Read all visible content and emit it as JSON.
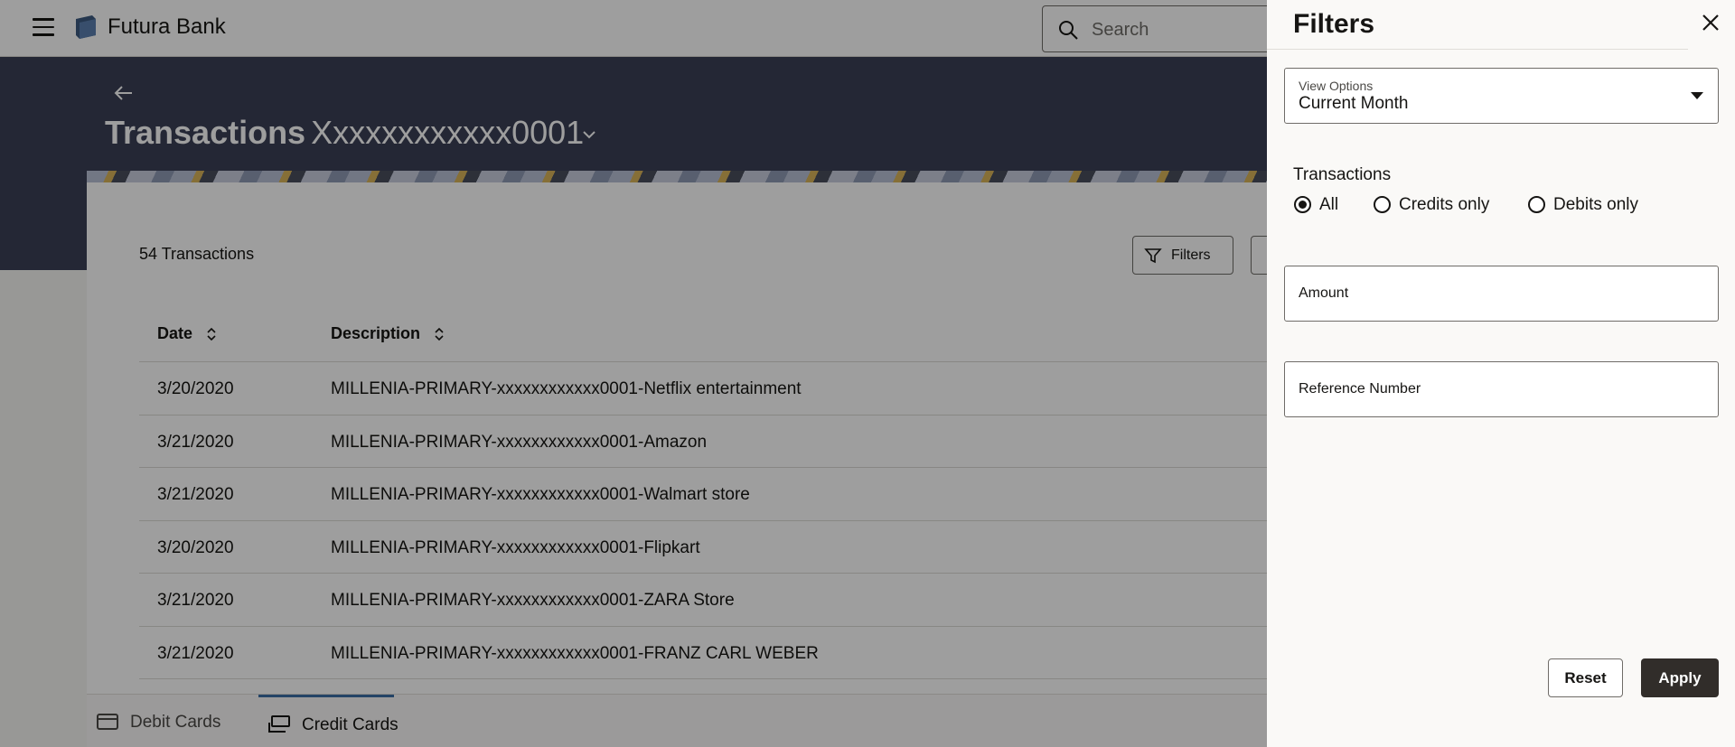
{
  "header": {
    "brand": "Futura Bank",
    "search_placeholder": "Search"
  },
  "page": {
    "title_bold": "Transactions",
    "account": "Xxxxxxxxxxxx0001"
  },
  "transactions": {
    "count_label": "54 Transactions",
    "filters_label": "Filters",
    "columns": {
      "date": "Date",
      "description": "Description"
    },
    "rows": [
      {
        "date": "3/20/2020",
        "description": "MILLENIA-PRIMARY-xxxxxxxxxxxx0001-Netflix entertainment"
      },
      {
        "date": "3/21/2020",
        "description": "MILLENIA-PRIMARY-xxxxxxxxxxxx0001-Amazon"
      },
      {
        "date": "3/21/2020",
        "description": "MILLENIA-PRIMARY-xxxxxxxxxxxx0001-Walmart store"
      },
      {
        "date": "3/20/2020",
        "description": "MILLENIA-PRIMARY-xxxxxxxxxxxx0001-Flipkart"
      },
      {
        "date": "3/21/2020",
        "description": "MILLENIA-PRIMARY-xxxxxxxxxxxx0001-ZARA Store"
      },
      {
        "date": "3/21/2020",
        "description": "MILLENIA-PRIMARY-xxxxxxxxxxxx0001-FRANZ CARL WEBER"
      }
    ]
  },
  "bottom_tabs": [
    {
      "label": "Debit Cards",
      "icon": "card-icon"
    },
    {
      "label": "Credit Cards",
      "icon": "transfer-icon",
      "active": true
    }
  ],
  "filter_panel": {
    "title": "Filters",
    "view_options": {
      "label": "View Options",
      "value": "Current Month"
    },
    "transactions_group": {
      "label": "Transactions",
      "options": [
        "All",
        "Credits only",
        "Debits only"
      ],
      "selected": "All"
    },
    "amount_placeholder": "Amount",
    "reference_placeholder": "Reference Number",
    "reset_label": "Reset",
    "apply_label": "Apply"
  },
  "colors": {
    "hero_bg": "#3a3f56",
    "primary_button": "#312d2a",
    "active_tab_accent": "#3a6ea5"
  }
}
